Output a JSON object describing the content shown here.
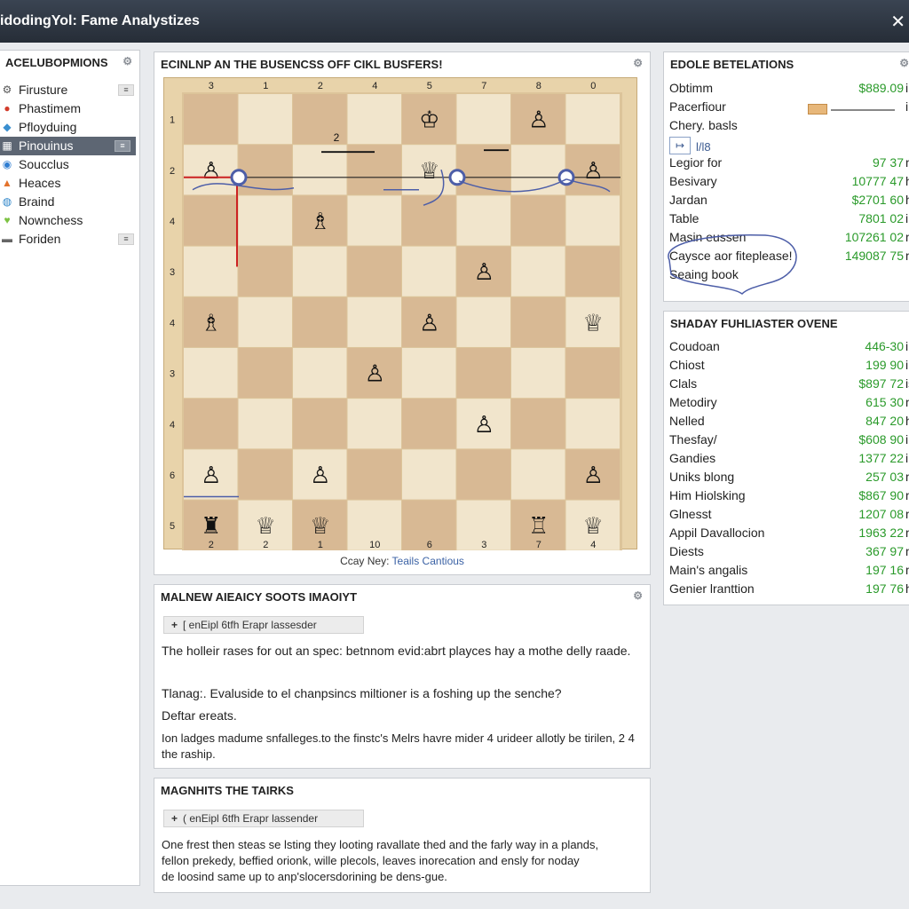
{
  "window": {
    "title": "idodingYol: Fame Analystizes",
    "close_glyph": "✕"
  },
  "sidebar": {
    "header": "ACELUBOPMIONS",
    "header_icon": "settings-icon",
    "items": [
      {
        "label": "Firusture",
        "icon": "tree-icon",
        "icon_color": "#555555",
        "has_button": true
      },
      {
        "label": "Phastimem",
        "icon": "pin-icon",
        "icon_color": "#d23b2a",
        "has_button": false
      },
      {
        "label": "Pfloyduing",
        "icon": "leaf-icon",
        "icon_color": "#3a8fd0",
        "has_button": false
      },
      {
        "label": "Pinouinus",
        "icon": "grid-icon",
        "icon_color": "#ffffff",
        "has_button": true,
        "active": true
      },
      {
        "label": "Soucclus",
        "icon": "globe-icon",
        "icon_color": "#2e7dd1",
        "has_button": false
      },
      {
        "label": "Heaces",
        "icon": "flame-icon",
        "icon_color": "#e3722b",
        "has_button": false
      },
      {
        "label": "Braind",
        "icon": "brain-icon",
        "icon_color": "#2f86c9",
        "has_button": false
      },
      {
        "label": "Nownchess",
        "icon": "heart-icon",
        "icon_color": "#7cc242",
        "has_button": false
      },
      {
        "label": "Foriden",
        "icon": "folder-icon",
        "icon_color": "#666666",
        "has_button": true
      }
    ]
  },
  "board": {
    "header": "ECINLNP AN THE BUSENCSS OFF CIKL BUSFERS!",
    "top_labels": [
      "3",
      "1",
      "2",
      "4",
      "5",
      "7",
      "8",
      "0"
    ],
    "bottom_labels": [
      "2",
      "2",
      "1",
      "10",
      "6",
      "3",
      "7",
      "4"
    ],
    "left_labels": [
      "1",
      "2",
      "4",
      "3",
      "4",
      "3",
      "4",
      "6",
      "5"
    ],
    "caption_prefix": "Ccay Ney:",
    "caption_link": "Teails Cantious",
    "pieces": [
      {
        "glyph": "♙",
        "col": 0,
        "row": 1
      },
      {
        "glyph": "♕",
        "col": 4,
        "row": 1
      },
      {
        "glyph": "♙",
        "col": 7,
        "row": 1
      },
      {
        "glyph": "♗",
        "col": 2,
        "row": 2
      },
      {
        "glyph": "♙",
        "col": 5,
        "row": 3
      },
      {
        "glyph": "♗",
        "col": 0,
        "row": 4
      },
      {
        "glyph": "♕",
        "col": 7,
        "row": 4
      },
      {
        "glyph": "♙",
        "col": 4,
        "row": 4
      },
      {
        "glyph": "♙",
        "col": 3,
        "row": 5
      },
      {
        "glyph": "♙",
        "col": 5,
        "row": 6
      },
      {
        "glyph": "♙",
        "col": 0,
        "row": 7
      },
      {
        "glyph": "♙",
        "col": 2,
        "row": 7
      },
      {
        "glyph": "♙",
        "col": 7,
        "row": 7
      },
      {
        "glyph": "♜",
        "col": 0,
        "row": 8
      },
      {
        "glyph": "♕",
        "col": 1,
        "row": 8
      },
      {
        "glyph": "♕",
        "col": 2,
        "row": 8
      },
      {
        "glyph": "♖",
        "col": 6,
        "row": 8
      },
      {
        "glyph": "♕",
        "col": 7,
        "row": 8
      },
      {
        "glyph": "♔",
        "col": 4,
        "row": 0
      },
      {
        "glyph": "♙",
        "col": 6,
        "row": 0
      }
    ],
    "annotation_2": "2"
  },
  "analysis": {
    "header": "MALNEW AIEAICY SOOTS IMAOIYT",
    "header_icon": "settings-icon",
    "pill": "[ enEipl 6tfh Erapr lassesder",
    "lines": [
      "The holleir rases for out an spec: betnnom evid:abrt playces hay a mothe delly raade.",
      "Tlanag:. Evaluside to el chanpsincs miltioner is a foshing up the senche?",
      "Deftar ereats.",
      "Ion ladges madume snfalleges.to the finstc's Melrs havre mider 4 urideer allotly be tirilen, 2 4  the raship."
    ]
  },
  "magnits": {
    "header": "MAGNHITS THE TAIRKS",
    "pill": "(  enEipl 6tfh Erapr lassender",
    "lines": [
      "One frest then steas se lsting they looting ravallate thed and the farly way in a plands,",
      "fellon prekedy, beffied orionk, wille plecols, leaves inorecation and ensly for noday",
      "de loosind same up to anp'slocersdorining be dens-gue."
    ]
  },
  "relations": {
    "header": "EDOLE BETELATIONS",
    "header_icon": "settings-icon",
    "rows": [
      {
        "name": "Obtimm",
        "value": "$889.09",
        "unit": "in"
      },
      {
        "name": "Pacerfiour",
        "slider": true,
        "unit": "in"
      },
      {
        "name": "Chery. basls"
      },
      {
        "name": "",
        "mini_button": "↦",
        "mini_label": "l/l8"
      },
      {
        "name": "Legior for",
        "value": "97 37",
        "unit": "m"
      },
      {
        "name": "Besivary",
        "value": "10777 47",
        "unit": "ht"
      },
      {
        "name": "Jardan",
        "value": "$2701 60",
        "unit": "he"
      },
      {
        "name": "Table",
        "value": "7801 02",
        "unit": "in"
      },
      {
        "name": "Masin eussen",
        "value": "107261 02",
        "unit": "m"
      },
      {
        "name": "Caysce aor fiteplease!",
        "value": "149087 75",
        "unit": "m"
      },
      {
        "name": "Seaing book"
      }
    ]
  },
  "shady": {
    "header": "SHADAY FUHLIASTER OVENE",
    "rows": [
      {
        "name": "Coudoan",
        "value": "446-30",
        "unit": "in"
      },
      {
        "name": "Chiost",
        "value": "199 90",
        "unit": "in"
      },
      {
        "name": "Clals",
        "value": "$897 72",
        "unit": "is"
      },
      {
        "name": "Metodiry",
        "value": "615 30",
        "unit": "m"
      },
      {
        "name": "Nelled",
        "value": "847 20",
        "unit": "ht"
      },
      {
        "name": "Thesfay/",
        "value": "$608 90",
        "unit": "in"
      },
      {
        "name": "Gandies",
        "value": "1377 22",
        "unit": "in"
      },
      {
        "name": "Uniks blong",
        "value": "257 03",
        "unit": "m"
      },
      {
        "name": "Him Hiolsking",
        "value": "$867 90",
        "unit": "m"
      },
      {
        "name": "Glnesst",
        "value": "1207 08",
        "unit": "m"
      },
      {
        "name": "Appil Davallocion",
        "value": "1963 22",
        "unit": "m"
      },
      {
        "name": "Diests",
        "value": "367 97",
        "unit": "m"
      },
      {
        "name": "Main's angalis",
        "value": "197 16",
        "unit": "m"
      },
      {
        "name": "Genier lranttion",
        "value": "197 76",
        "unit": "ht"
      }
    ]
  },
  "colors": {
    "accent": "#5d6673",
    "value_green": "#2a9a2a",
    "arrow": "#4d5ea8",
    "highlight_red": "#cc2222"
  }
}
